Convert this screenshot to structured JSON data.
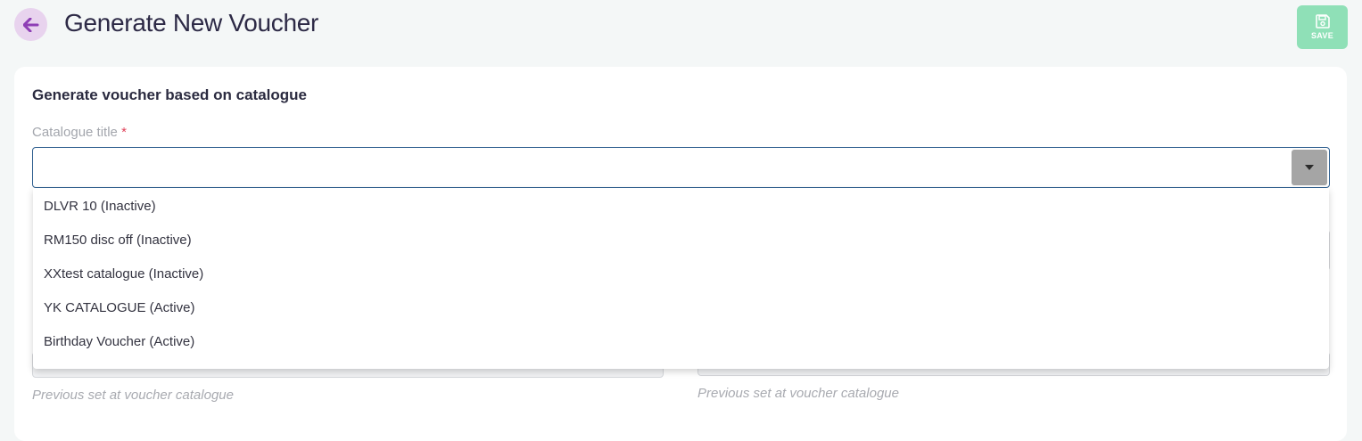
{
  "header": {
    "title": "Generate New Voucher",
    "save_label": "SAVE"
  },
  "form": {
    "section_title": "Generate voucher based on catalogue",
    "catalogue_label": "Catalogue title",
    "required_mark": "*",
    "catalogue_value": "",
    "options": [
      "DLVR 10 (Inactive)",
      "RM150 disc off (Inactive)",
      "XXtest catalogue (Inactive)",
      "YK CATALOGUE (Active)",
      "Birthday Voucher (Active)"
    ],
    "hint_left": "Previous set at voucher catalogue",
    "hint_right": "Previous set at voucher catalogue"
  },
  "icons": {
    "back": "arrow-left-icon",
    "save": "floppy-disk-icon",
    "dropdown": "caret-down-icon"
  },
  "colors": {
    "accent_purple": "#8e3fb5",
    "back_bg": "#e8d3ee",
    "save_bg": "#8fe0b7",
    "required": "#e0435b"
  }
}
